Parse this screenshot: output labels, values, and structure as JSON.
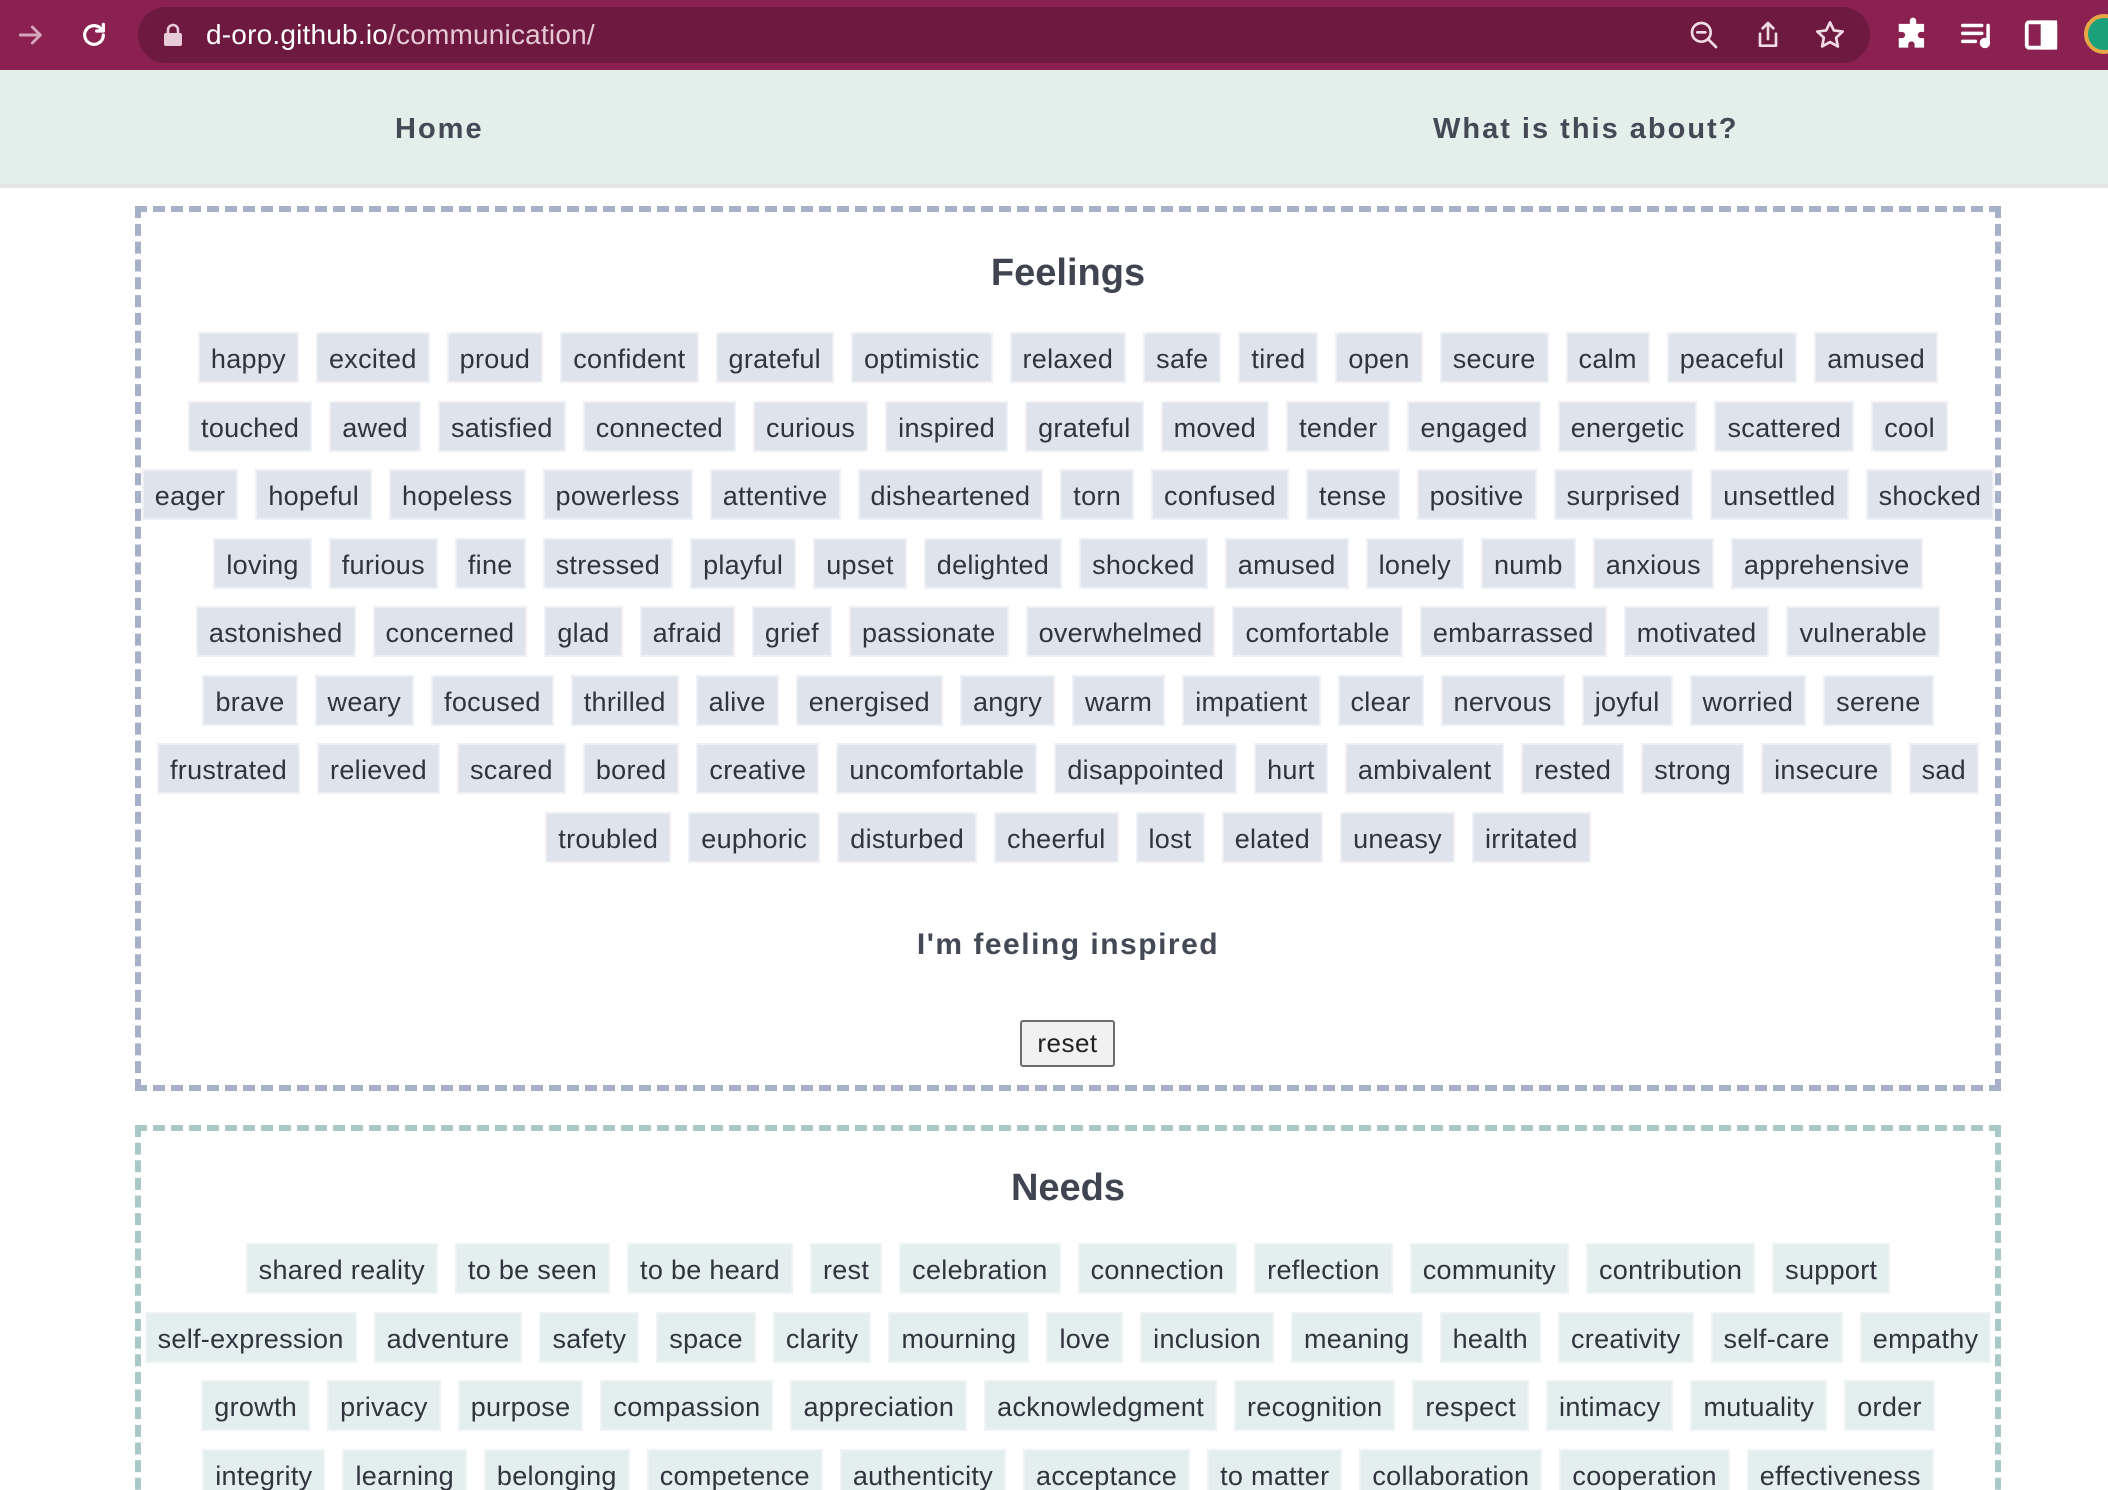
{
  "browser": {
    "url_host": "d-oro.github.io",
    "url_path": "/communication/"
  },
  "nav": {
    "home": "Home",
    "about": "What is this about?"
  },
  "feelings": {
    "title": "Feelings",
    "rows": [
      [
        "happy",
        "excited",
        "proud",
        "confident",
        "grateful",
        "optimistic",
        "relaxed",
        "safe",
        "tired",
        "open",
        "secure",
        "calm",
        "peaceful",
        "amused"
      ],
      [
        "touched",
        "awed",
        "satisfied",
        "connected",
        "curious",
        "inspired",
        "grateful",
        "moved",
        "tender",
        "engaged",
        "energetic",
        "scattered",
        "cool"
      ],
      [
        "eager",
        "hopeful",
        "hopeless",
        "powerless",
        "attentive",
        "disheartened",
        "torn",
        "confused",
        "tense",
        "positive",
        "surprised",
        "unsettled",
        "shocked"
      ],
      [
        "loving",
        "furious",
        "fine",
        "stressed",
        "playful",
        "upset",
        "delighted",
        "shocked",
        "amused",
        "lonely",
        "numb",
        "anxious",
        "apprehensive"
      ],
      [
        "astonished",
        "concerned",
        "glad",
        "afraid",
        "grief",
        "passionate",
        "overwhelmed",
        "comfortable",
        "embarrassed",
        "motivated",
        "vulnerable"
      ],
      [
        "brave",
        "weary",
        "focused",
        "thrilled",
        "alive",
        "energised",
        "angry",
        "warm",
        "impatient",
        "clear",
        "nervous",
        "joyful",
        "worried",
        "serene"
      ],
      [
        "frustrated",
        "relieved",
        "scared",
        "bored",
        "creative",
        "uncomfortable",
        "disappointed",
        "hurt",
        "ambivalent",
        "rested",
        "strong",
        "insecure",
        "sad"
      ],
      [
        "troubled",
        "euphoric",
        "disturbed",
        "cheerful",
        "lost",
        "elated",
        "uneasy",
        "irritated"
      ]
    ],
    "selection_text": "I'm feeling inspired",
    "reset_label": "reset"
  },
  "needs": {
    "title": "Needs",
    "rows": [
      [
        "shared reality",
        "to be seen",
        "to be heard",
        "rest",
        "celebration",
        "connection",
        "reflection",
        "community",
        "contribution",
        "support"
      ],
      [
        "self-expression",
        "adventure",
        "safety",
        "space",
        "clarity",
        "mourning",
        "love",
        "inclusion",
        "meaning",
        "health",
        "creativity",
        "self-care",
        "empathy"
      ],
      [
        "growth",
        "privacy",
        "purpose",
        "compassion",
        "appreciation",
        "acknowledgment",
        "recognition",
        "respect",
        "intimacy",
        "mutuality",
        "order"
      ],
      [
        "integrity",
        "learning",
        "belonging",
        "competence",
        "authenticity",
        "acceptance",
        "to matter",
        "collaboration",
        "cooperation",
        "effectiveness"
      ]
    ]
  },
  "icons": {
    "forward": "forward-arrow-icon",
    "reload": "reload-icon",
    "lock": "lock-icon",
    "zoom": "zoom-icon",
    "share": "share-icon",
    "bookmark": "star-icon",
    "extensions": "puzzle-icon",
    "reading_list": "reading-list-icon",
    "side_panel": "side-panel-icon"
  },
  "colors": {
    "browser_bar": "#8a2150",
    "url_pill": "#6e1a40",
    "nav_bg": "#e3efea",
    "feelings_border": "#a7b0c9",
    "needs_border": "#a9c8c8",
    "feeling_chip": "#dfe3ec",
    "need_chip": "#e3eeee"
  }
}
